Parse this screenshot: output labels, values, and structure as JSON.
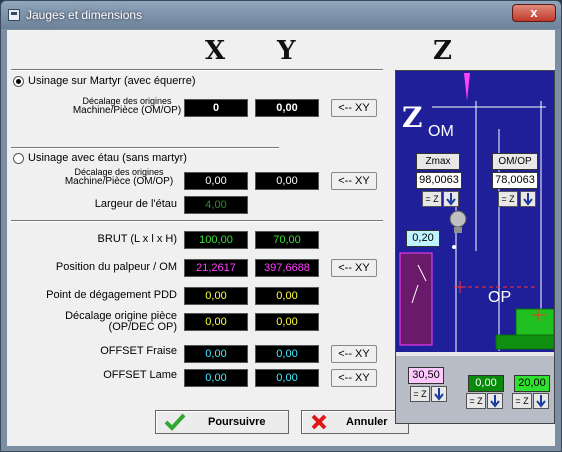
{
  "window": {
    "title": "Jauges et dimensions",
    "close_label": "x"
  },
  "headers": {
    "x": "X",
    "y": "Y",
    "z": "Z"
  },
  "mode_martyr": {
    "label": "Usinage sur Martyr (avec équerre)",
    "selected": true
  },
  "decalage1": {
    "label_line1": "Décalage des origines",
    "label_line2": "Machine/Pièce (OM/OP)",
    "x": "0",
    "y": "0,00",
    "button": "<-- XY"
  },
  "mode_etau": {
    "label": "Usinage avec étau (sans martyr)",
    "selected": false
  },
  "decalage2": {
    "label_line1": "Décalage des origines",
    "label_line2": "Machine/Pièce (OM/OP)",
    "x": "0,00",
    "y": "0,00",
    "button": "<-- XY"
  },
  "largeur": {
    "label": "Largeur de l'étau",
    "value": "4,00"
  },
  "brut": {
    "label": "BRUT (L x l x H)",
    "x": "100,00",
    "y": "70,00"
  },
  "palpeur": {
    "label": "Position du palpeur / OM",
    "x": "21,2617",
    "y": "397,6688",
    "button": "<-- XY"
  },
  "pdd": {
    "label": "Point de dégagement PDD",
    "x": "0,00",
    "y": "0,00"
  },
  "decop": {
    "label_line1": "Décalage origine pièce",
    "label_line2": "(OP/DEC OP)",
    "x": "0,00",
    "y": "0,00"
  },
  "offset_fraise": {
    "label": "OFFSET Fraise",
    "x": "0,00",
    "y": "0,00",
    "button": "<-- XY"
  },
  "offset_lame": {
    "label": "OFFSET Lame",
    "x": "0,00",
    "y": "0,00",
    "button": "<-- XY"
  },
  "buttons": {
    "continue": "Poursuivre",
    "cancel": "Annuler"
  },
  "scheme": {
    "z_label": "Z",
    "om_label": "OM",
    "op_label": "OP",
    "zmax_label": "Zmax",
    "zmax_value": "98,0063",
    "omop_label": "OM/OP",
    "omop_value": "78,0063",
    "eq_z": "= Z",
    "probe_value": "0,20",
    "etau_value": "30,50",
    "piece_value": "0,00",
    "martyr_value": "20,00"
  },
  "colors": {
    "field_bg": "#000000",
    "green": "#38e038",
    "magenta": "#ff40ff",
    "yellow": "#ffff40",
    "cyan": "#40e8ff",
    "scheme_bg": "#1f1f9a"
  }
}
